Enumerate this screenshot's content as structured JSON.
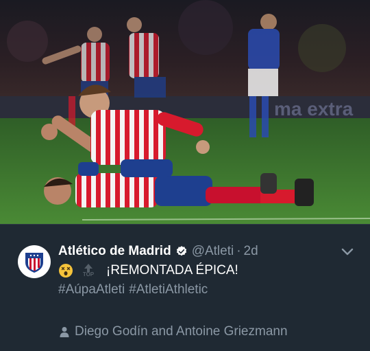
{
  "photo": {
    "alt_subject": "football-celebration-photo",
    "banner_text": "ma extra"
  },
  "tweet": {
    "author_name": "Atlético de Madrid",
    "handle": "@Atleti",
    "separator": "·",
    "timestamp": "2d",
    "headline": "¡REMONTADA ÉPICA!",
    "top_label": "TOP",
    "hashtags": [
      "#AúpaAtleti",
      "#AtletiAthletic"
    ],
    "tagged_people": "Diego Godín and Antoine Griezmann"
  },
  "icons": {
    "verified": "verified-badge-icon",
    "chevron": "chevron-down-icon",
    "emoji": "dizzy-face-emoji",
    "top": "top-arrow-icon",
    "person": "person-icon",
    "avatar": "atletico-crest"
  },
  "colors": {
    "background": "#1f2933",
    "text_primary": "#ffffff",
    "text_secondary": "#8b98a5",
    "pitch_green": "#3f7a2e",
    "atleti_red": "#c8102e",
    "atleti_blue": "#1e3f8f"
  }
}
